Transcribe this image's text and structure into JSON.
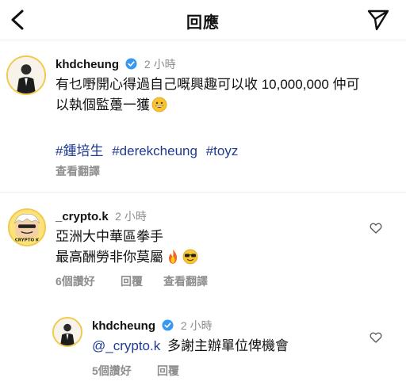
{
  "header": {
    "title": "回應"
  },
  "caption": {
    "username": "khdcheung",
    "time": "2 小時",
    "text_line1": "有乜嘢開心得過自己嘅興趣可以收 10,000,000 仲可",
    "text_line2": "以執個監躉一獲",
    "hashtags": [
      "#鍾培生",
      "#derekcheung",
      "#toyz"
    ],
    "translate_label": "查看翻譯"
  },
  "comments": [
    {
      "username": "_crypto.k",
      "time": "2 小時",
      "line1": "亞洲大中華區拳手",
      "line2": "最高酬勞非你莫屬",
      "avatar_text": "CRYPTO K",
      "likes_label": "6個讚好",
      "reply_label": "回覆",
      "translate_label": "查看翻譯"
    }
  ],
  "reply": {
    "username": "khdcheung",
    "time": "2 小時",
    "mention": "@_crypto.k",
    "text": "多謝主辦單位俾機會",
    "likes_label": "5個讚好",
    "reply_label": "回覆"
  },
  "colors": {
    "link": "#1f3a93",
    "verified": "#3897f0",
    "muted": "#8e8e8e",
    "avatar_ring": "#f2c94c"
  },
  "icons": [
    "chevron-left-icon",
    "send-icon",
    "verified-icon",
    "grinning-emoji-icon",
    "fire-emoji-icon",
    "sunglasses-emoji-icon",
    "heart-outline-icon"
  ]
}
